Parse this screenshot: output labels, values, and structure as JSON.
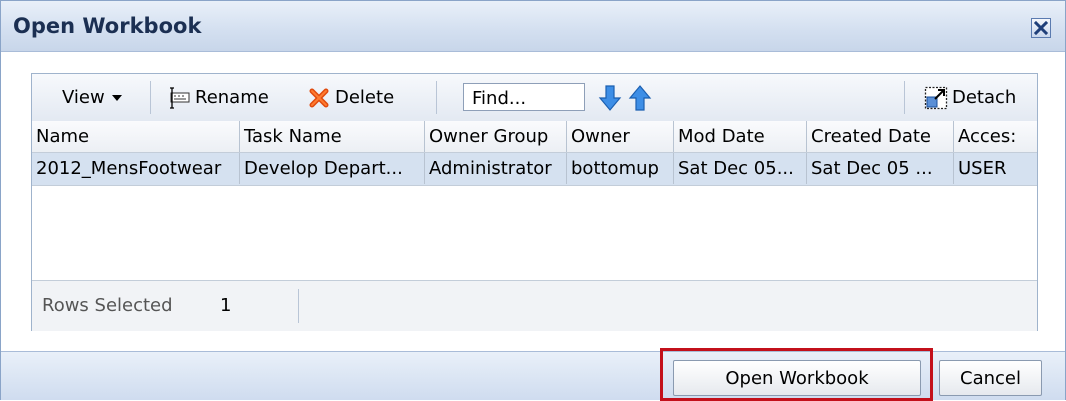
{
  "dialog": {
    "title": "Open Workbook"
  },
  "toolbar": {
    "view_label": "View",
    "rename_label": "Rename",
    "delete_label": "Delete",
    "find_value": "Find...",
    "detach_label": "Detach"
  },
  "table": {
    "columns": [
      "Name",
      "Task Name",
      "Owner Group",
      "Owner",
      "Mod Date",
      "Created Date",
      "Acces:"
    ],
    "rows": [
      [
        "2012_MensFootwear",
        "Develop Depart...",
        "Administrator",
        "bottomup",
        "Sat Dec 05...",
        "Sat Dec 05 ...",
        "USER"
      ]
    ]
  },
  "status": {
    "rows_selected_label": "Rows Selected",
    "rows_selected_value": "1"
  },
  "footer": {
    "open_label": "Open Workbook",
    "cancel_label": "Cancel"
  },
  "colors": {
    "highlight": "#c3101b",
    "selected_row": "#d5e1f0",
    "title_text": "#1b2f52"
  }
}
